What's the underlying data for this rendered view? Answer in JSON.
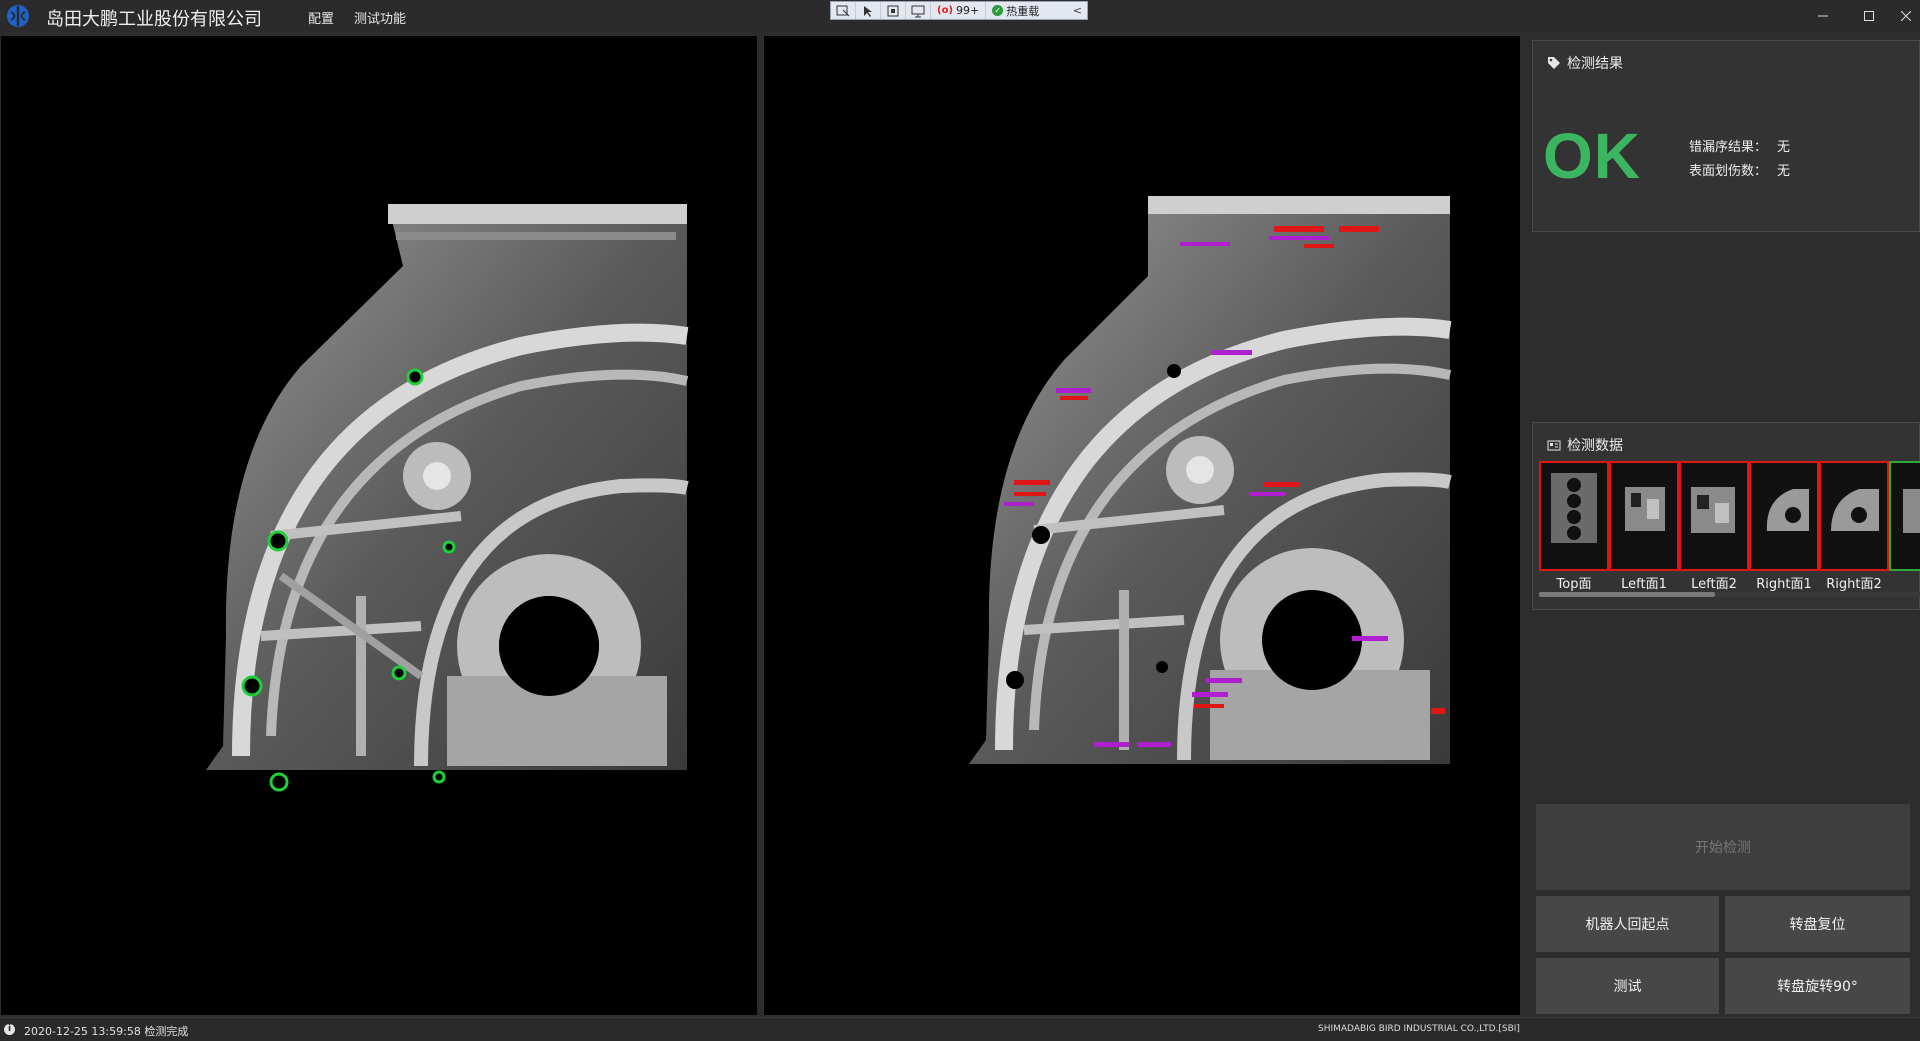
{
  "window": {
    "title": "岛田大鹏工业股份有限公司",
    "menu": [
      "配置",
      "测试功能"
    ],
    "controls": [
      "minimize",
      "maximize",
      "close"
    ]
  },
  "debug_toolbar": {
    "error_count": "99+",
    "hot_reload_label": "热重载",
    "collapse_glyph": "<"
  },
  "inspection_result": {
    "title": "检测结果",
    "status": "OK",
    "status_color": "#3bb55f",
    "metrics": [
      {
        "label": "错漏序结果：",
        "value": "无"
      },
      {
        "label": "表面划伤数：",
        "value": "无"
      }
    ]
  },
  "inspection_data": {
    "title": "检测数据",
    "thumbnails": [
      {
        "label": "Top面",
        "frame_color": "#e01616"
      },
      {
        "label": "Left面1",
        "frame_color": "#e01616"
      },
      {
        "label": "Left面2",
        "frame_color": "#e01616"
      },
      {
        "label": "Right面1",
        "frame_color": "#e01616"
      },
      {
        "label": "Right面2",
        "frame_color": "#e01616"
      },
      {
        "label": "",
        "frame_color": "#2fa83a"
      }
    ]
  },
  "buttons": {
    "start": "开始检测",
    "robot_home": "机器人回起点",
    "turntable_reset": "转盘复位",
    "test": "测试",
    "turntable_rotate": "转盘旋转90°"
  },
  "status_bar": {
    "message": "2020-12-25 13:59:58 检测完成",
    "company": "SHIMADABIG BIRD INDUSTRIAL CO.,LTD.[SBI]"
  },
  "colors": {
    "hole_ok_marker": "#1fcf3a",
    "defect_marker": "#e01616",
    "defect_label": "#b01fcf"
  }
}
